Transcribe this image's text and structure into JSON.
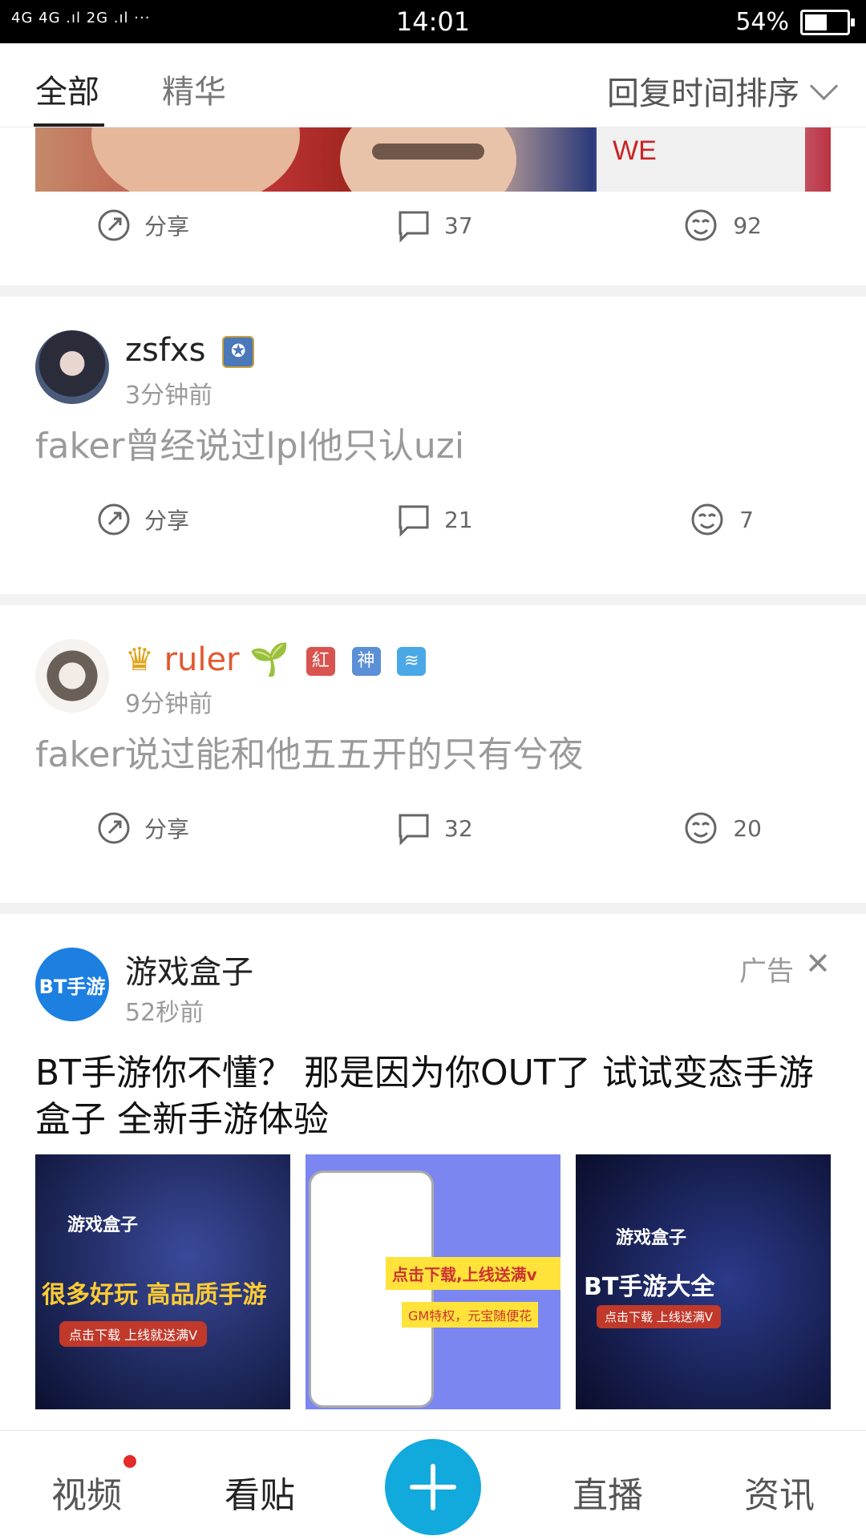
{
  "status_bar": {
    "network": "4G 4G .ıl 2G .ıl ···",
    "time": "14:01",
    "battery_text": "54%",
    "battery_level": 0.54
  },
  "tabs": {
    "items": [
      {
        "label": "全部",
        "active": true
      },
      {
        "label": "精华",
        "active": false
      }
    ],
    "sort_label": "回复时间排序"
  },
  "first_post": {
    "share_label": "分享",
    "comment_count": "37",
    "like_count": "92"
  },
  "posts": [
    {
      "username": "zsfxs",
      "time": "3分钟前",
      "content": "faker曾经说过lpl他只认uzi",
      "share_label": "分享",
      "comment_count": "21",
      "like_count": "7"
    },
    {
      "username": "ruler",
      "time": "9分钟前",
      "content": "faker说过能和他五五开的只有兮夜",
      "badges": [
        "紅",
        "神",
        "≋"
      ],
      "share_label": "分享",
      "comment_count": "32",
      "like_count": "20"
    }
  ],
  "ad": {
    "username": "游戏盒子",
    "time": "52秒前",
    "ad_label": "广告",
    "avatar_text": "BT手游",
    "title": "BT手游你不懂？  那是因为你OUT了  试试变态手游盒子  全新手游体验",
    "images": [
      {
        "brand": "游戏盒子",
        "headline": "很多好玩 高品质手游",
        "cta": "点击下载 上线就送满V"
      },
      {
        "headline": "点击下载,上线送满v",
        "sub": "GM特权，元宝随便花"
      },
      {
        "brand": "游戏盒子",
        "headline": "BT手游大全",
        "cta": "点击下载 上线送满V"
      }
    ]
  },
  "bottom_nav": {
    "items": [
      {
        "label": "视频"
      },
      {
        "label": "看贴"
      },
      {
        "label": "直播"
      },
      {
        "label": "资讯"
      }
    ],
    "colors": {
      "fab": "#12a9dd",
      "dot": "#e52a2a"
    }
  }
}
